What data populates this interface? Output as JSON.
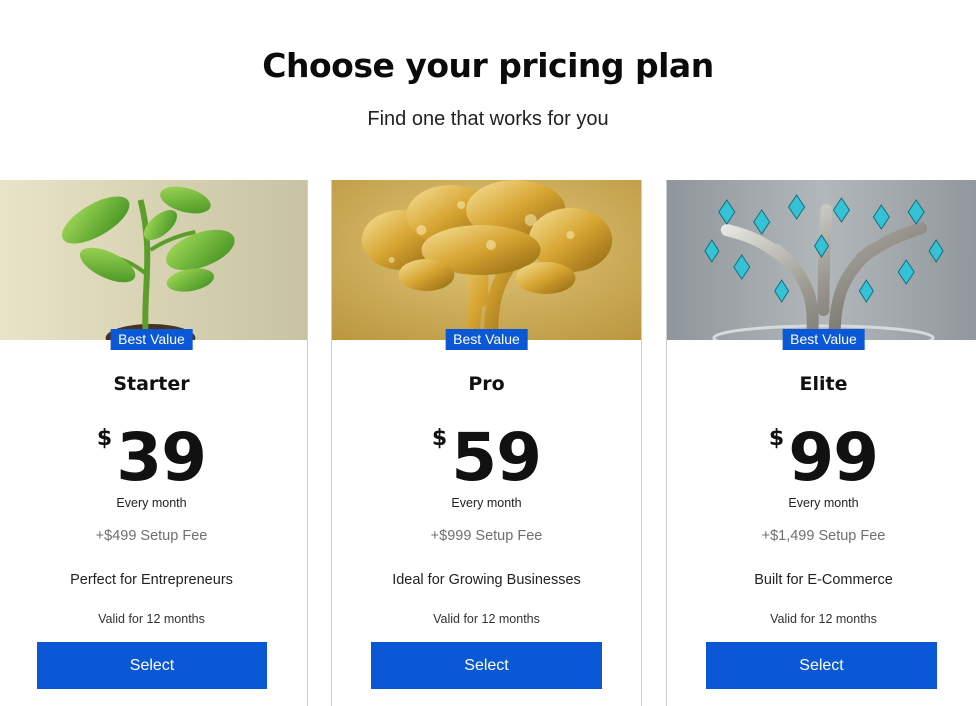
{
  "header": {
    "title": "Choose your pricing plan",
    "subtitle": "Find one that works for you"
  },
  "plans": [
    {
      "badge": "Best Value",
      "name": "Starter",
      "currency": "$",
      "price": "39",
      "period": "Every month",
      "setup_fee": "+$499 Setup Fee",
      "tagline": "Perfect for Entrepreneurs",
      "validity": "Valid for 12 months",
      "button_label": "Select",
      "image_icon": "sprout-plant-icon"
    },
    {
      "badge": "Best Value",
      "name": "Pro",
      "currency": "$",
      "price": "59",
      "period": "Every month",
      "setup_fee": "+$999 Setup Fee",
      "tagline": "Ideal for Growing Businesses",
      "validity": "Valid for 12 months",
      "button_label": "Select",
      "image_icon": "golden-tree-icon"
    },
    {
      "badge": "Best Value",
      "name": "Elite",
      "currency": "$",
      "price": "99",
      "period": "Every month",
      "setup_fee": "+$1,499 Setup Fee",
      "tagline": "Built for E-Commerce",
      "validity": "Valid for 12 months",
      "button_label": "Select",
      "image_icon": "crystal-tree-icon"
    }
  ],
  "colors": {
    "accent": "#0a58d6",
    "button_text": "#ffffff",
    "muted_text": "#6f6f6f"
  }
}
